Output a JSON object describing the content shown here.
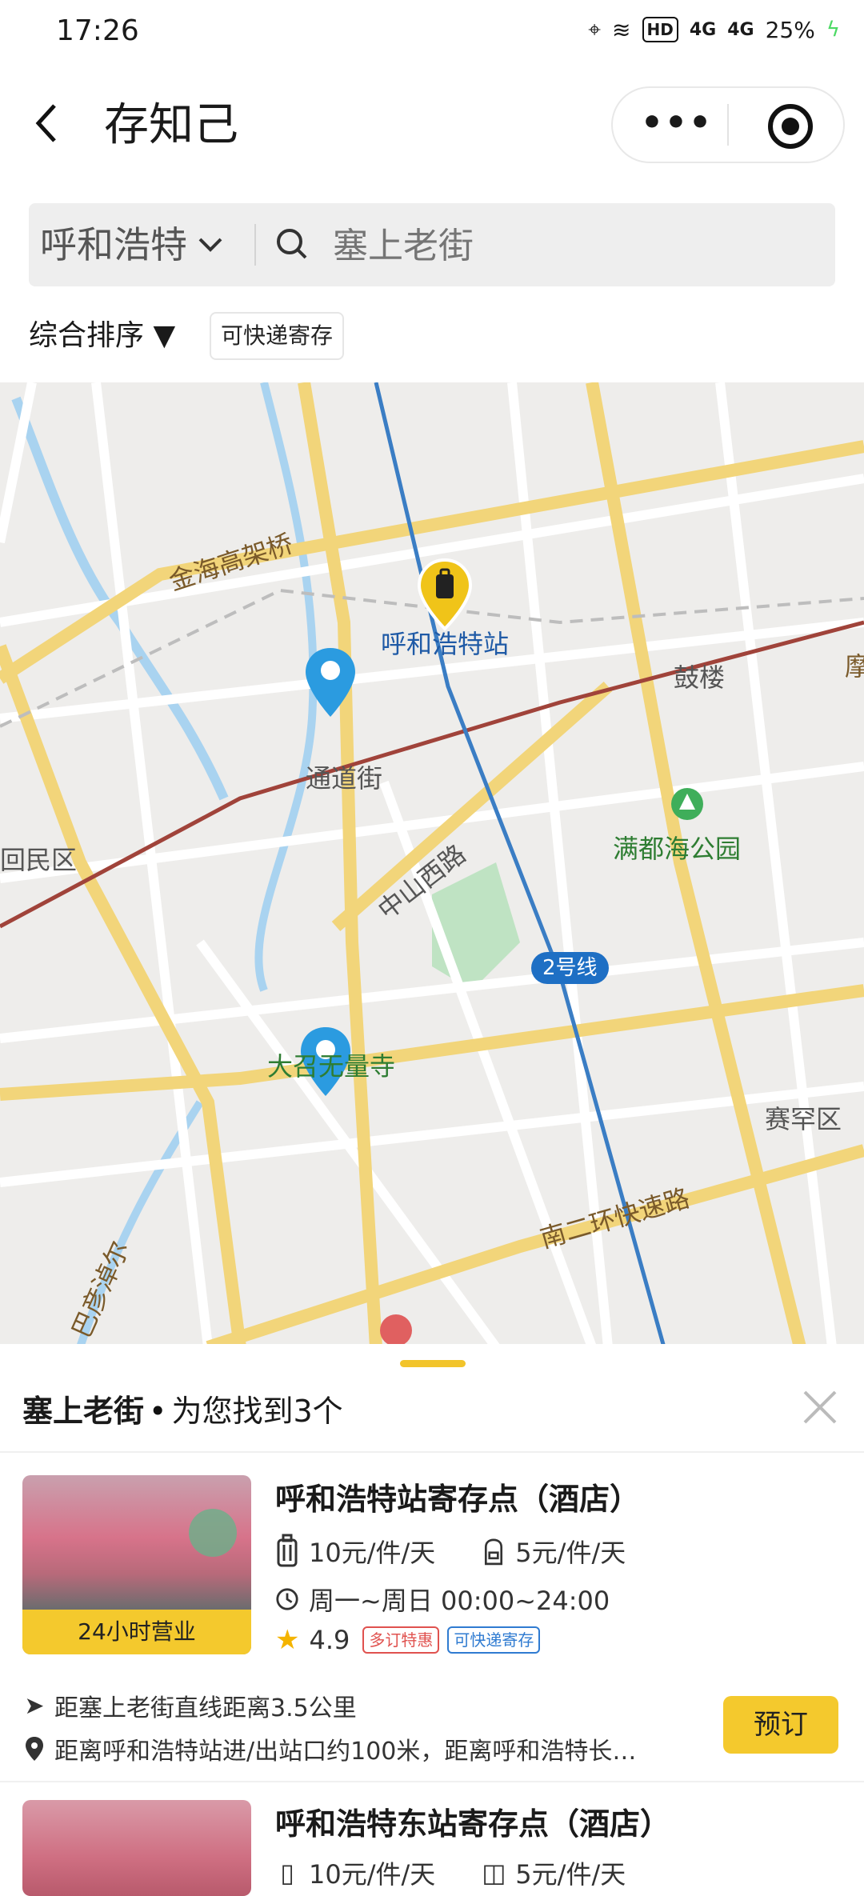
{
  "statusbar": {
    "time": "17:26",
    "hd": "HD",
    "signal1": "4G",
    "signal2": "4G",
    "battery": "25%"
  },
  "nav": {
    "back_icon": "chevron-left-icon",
    "title": "存知己",
    "more_label": "•••",
    "target_icon": "target-icon"
  },
  "search": {
    "city": "呼和浩特",
    "placeholder": "塞上老街"
  },
  "filters": {
    "sort_label": "综合排序 ▼",
    "tag_label": "可快递寄存"
  },
  "map": {
    "labels": {
      "jinhai": "金海高架桥",
      "station": "呼和浩特站",
      "gulou": "鼓楼",
      "mo": "摩",
      "tongdao": "通道街",
      "park": "满都海公园",
      "zhongshan": "中山西路",
      "huimin": "回民区",
      "line2": "2号线",
      "temple": "大召无量寺",
      "saihan": "赛罕区",
      "nanerhuan": "南二环快速路",
      "bayan": "巴彦淖尔"
    },
    "colors": {
      "main_road": "#f2d57a",
      "rail_line": "#a0433a",
      "metro": "#3a7dc4",
      "water": "#a9d3f0",
      "park": "#bfe3c3"
    }
  },
  "panel": {
    "query": "塞上老街",
    "result_text": "为您找到3个",
    "close_icon": "close-icon",
    "items": [
      {
        "name": "呼和浩特站寄存点（酒店）",
        "badge": "24小时营业",
        "price_large": "10元/件/天",
        "price_small": "5元/件/天",
        "hours": "周一~周日 00:00~24:00",
        "rating": "4.9",
        "tag1": "多订特惠",
        "tag2": "可快递寄存",
        "distance": "距塞上老街直线距离3.5公里",
        "address": "距离呼和浩特站进/出站口约100米，距离呼和浩特长…",
        "book_label": "预订"
      },
      {
        "name": "呼和浩特东站寄存点（酒店）",
        "price_large": "10元/件/天",
        "price_small": "5元/件/天"
      }
    ]
  }
}
